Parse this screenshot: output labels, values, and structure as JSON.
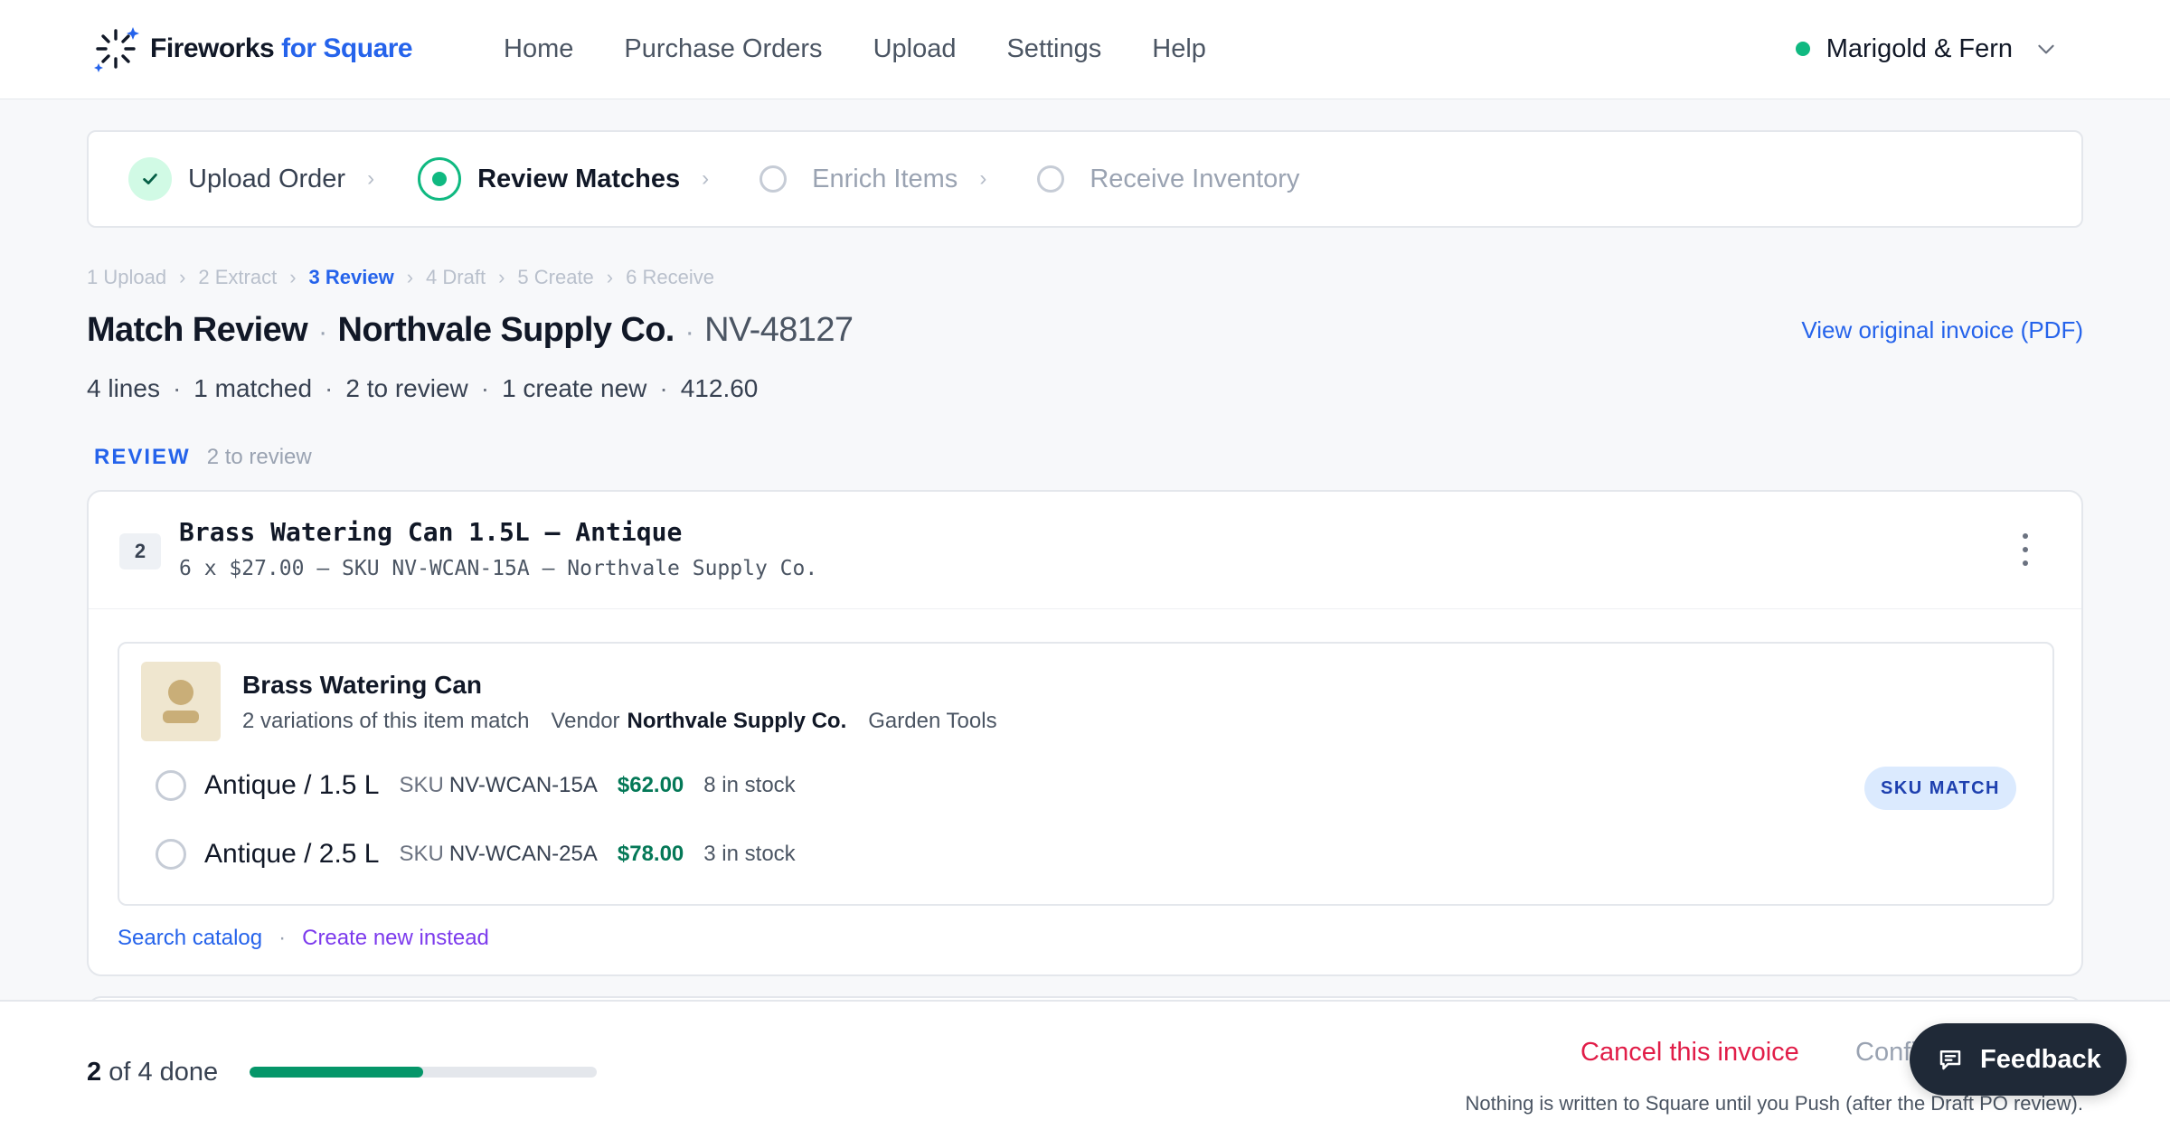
{
  "brand": {
    "name_part1": "Fireworks",
    "name_part2": "for Square",
    "icon": "fireworks-logo-icon"
  },
  "nav": {
    "items": [
      {
        "label": "Home"
      },
      {
        "label": "Purchase Orders"
      },
      {
        "label": "Upload"
      },
      {
        "label": "Settings"
      },
      {
        "label": "Help"
      }
    ]
  },
  "account": {
    "name": "Marigold & Fern",
    "status_color": "#10b981"
  },
  "stepper": {
    "steps": [
      {
        "label": "Upload Order",
        "state": "done"
      },
      {
        "label": "Review Matches",
        "state": "active"
      },
      {
        "label": "Enrich Items",
        "state": "todo"
      },
      {
        "label": "Receive Inventory",
        "state": "todo"
      }
    ]
  },
  "breadcrumb": {
    "items": [
      {
        "label": "1 Upload"
      },
      {
        "label": "2 Extract"
      },
      {
        "label": "3 Review"
      },
      {
        "label": "4 Draft"
      },
      {
        "label": "5 Create"
      },
      {
        "label": "6 Receive"
      }
    ],
    "current_index": 2
  },
  "page": {
    "title": "Match Review",
    "vendor": "Northvale Supply Co.",
    "invoice_number": "NV-48127",
    "view_pdf_label": "View original invoice (PDF)",
    "summary": {
      "lines": "4 lines",
      "matched": "1 matched",
      "to_review": "2 to review",
      "create_new": "1 create new",
      "total": "412.60"
    }
  },
  "section": {
    "label": "REVIEW",
    "count": "2 to review"
  },
  "line": {
    "number": "2",
    "name": "Brass Watering Can 1.5L – Antique",
    "meta": "6 x $27.00 – SKU NV-WCAN-15A – Northvale Supply Co.",
    "match": {
      "product_name": "Brass Watering Can",
      "variations_text": "2 variations of this item match",
      "vendor_label": "Vendor",
      "vendor": "Northvale Supply Co.",
      "category": "Garden Tools",
      "variations": [
        {
          "name": "Antique / 1.5 L",
          "sku_label": "SKU",
          "sku": "NV-WCAN-15A",
          "price": "$62.00",
          "stock": "8 in stock"
        },
        {
          "name": "Antique / 2.5 L",
          "sku_label": "SKU",
          "sku": "NV-WCAN-25A",
          "price": "$78.00",
          "stock": "3 in stock"
        }
      ],
      "badge": "SKU MATCH"
    },
    "actions": {
      "search": "Search catalog",
      "create_new": "Create new instead"
    }
  },
  "footer": {
    "progress_done": "2",
    "progress_text": "of 4 done",
    "progress_fraction": 0.5,
    "cancel_label": "Cancel this invoice",
    "confirm_label": "Confi",
    "note": "Nothing is written to Square until you Push (after the Draft PO review)."
  },
  "feedback": {
    "label": "Feedback",
    "icon": "chat-icon"
  },
  "colors": {
    "accent": "#2563eb",
    "success": "#10b981",
    "price": "#047857",
    "danger": "#e11d48",
    "create": "#7c3aed"
  }
}
